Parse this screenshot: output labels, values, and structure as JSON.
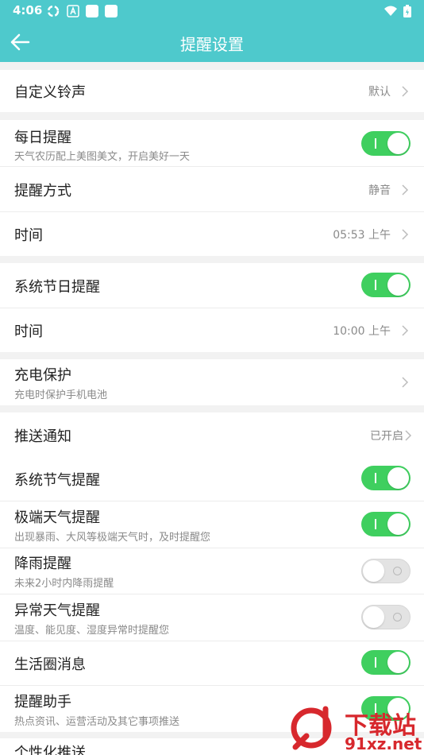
{
  "status_bar": {
    "time": "4:06",
    "icons": [
      "sync-icon",
      "a-icon",
      "square-icon",
      "square-icon",
      "wifi-icon",
      "battery-icon"
    ]
  },
  "app_bar": {
    "title": "提醒设置",
    "back_icon": "back-arrow-icon"
  },
  "colors": {
    "accent": "#4ec9cc",
    "toggle_on": "#3fcf5f",
    "toggle_off": "#e3e3e3"
  },
  "rows": {
    "ringtone": {
      "label": "自定义铃声",
      "value": "默认"
    },
    "daily": {
      "label": "每日提醒",
      "sub": "天气农历配上美图美文，开启美好一天",
      "on": true
    },
    "daily_mode": {
      "label": "提醒方式",
      "value": "静音"
    },
    "daily_time": {
      "label": "时间",
      "value": "05:53 上午"
    },
    "holiday": {
      "label": "系统节日提醒",
      "on": true
    },
    "holiday_time": {
      "label": "时间",
      "value": "10:00 上午"
    },
    "charge": {
      "label": "充电保护",
      "sub": "充电时保护手机电池"
    },
    "push": {
      "label": "推送通知",
      "value": "已开启"
    },
    "solar_term": {
      "label": "系统节气提醒",
      "on": true
    },
    "extreme": {
      "label": "极端天气提醒",
      "sub": "出现暴雨、大风等极端天气时，及时提醒您",
      "on": true
    },
    "rain": {
      "label": "降雨提醒",
      "sub": "未来2小时内降雨提醒",
      "on": false
    },
    "abnormal": {
      "label": "异常天气提醒",
      "sub": "温度、能见度、湿度异常时提醒您",
      "on": false
    },
    "circle": {
      "label": "生活圈消息",
      "on": true
    },
    "assistant": {
      "label": "提醒助手",
      "sub": "热点资讯、运营活动及其它事项推送",
      "on": true
    },
    "personalized": {
      "label": "个性化推送"
    }
  },
  "watermark": {
    "line1": "下载站",
    "line2": "91xz.net"
  }
}
